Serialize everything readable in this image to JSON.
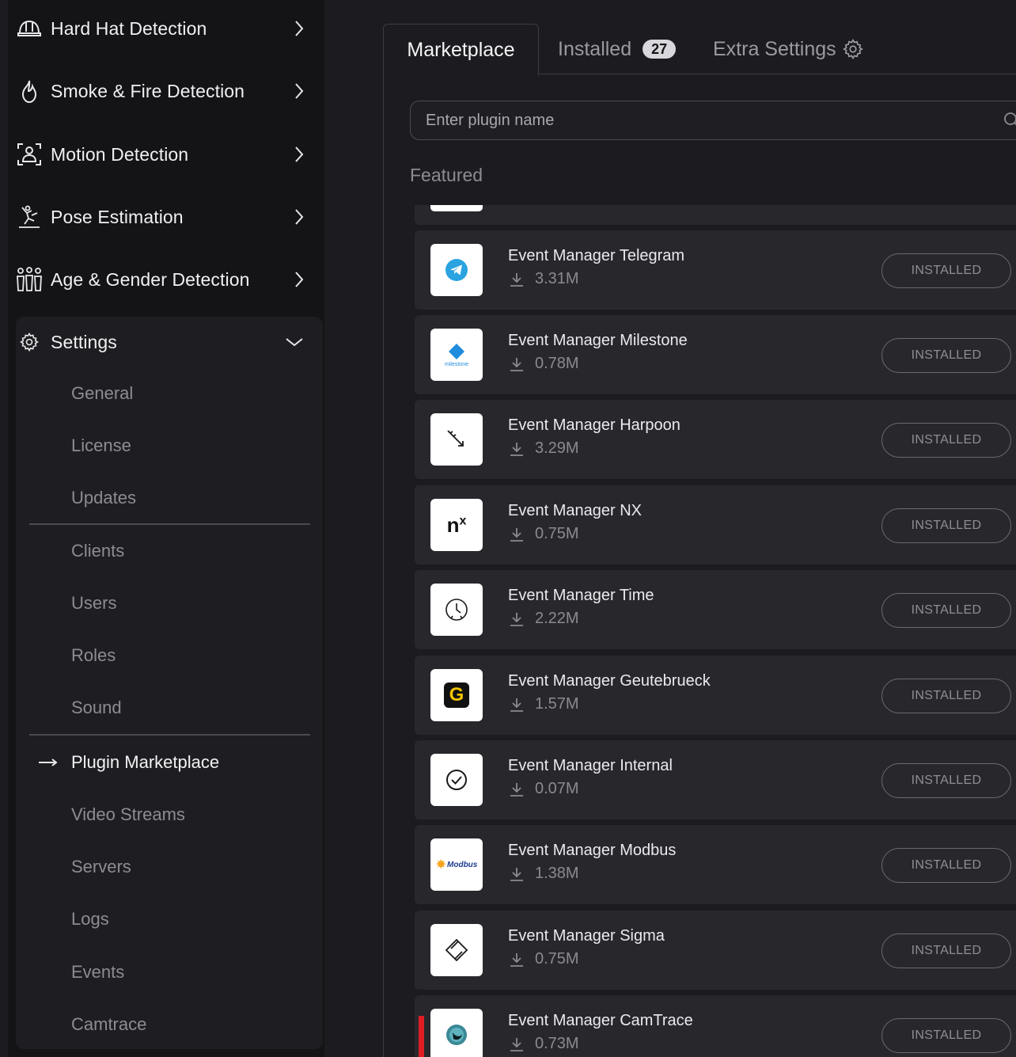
{
  "sidebar": {
    "nav": [
      {
        "label": "Hard Hat Detection",
        "icon": "hard-hat-icon"
      },
      {
        "label": "Smoke & Fire Detection",
        "icon": "fire-icon"
      },
      {
        "label": "Motion Detection",
        "icon": "motion-icon"
      },
      {
        "label": "Pose Estimation",
        "icon": "pose-icon"
      },
      {
        "label": "Age & Gender Detection",
        "icon": "people-icon"
      }
    ],
    "settings": {
      "label": "Settings",
      "icon": "gear-icon",
      "items": [
        {
          "label": "General"
        },
        {
          "label": "License"
        },
        {
          "label": "Updates"
        },
        {
          "label": "Clients"
        },
        {
          "label": "Users"
        },
        {
          "label": "Roles"
        },
        {
          "label": "Sound"
        },
        {
          "label": "Plugin Marketplace",
          "active": true
        },
        {
          "label": "Video Streams"
        },
        {
          "label": "Servers"
        },
        {
          "label": "Logs"
        },
        {
          "label": "Events"
        },
        {
          "label": "Camtrace"
        }
      ]
    }
  },
  "tabs": {
    "marketplace": "Marketplace",
    "installed": "Installed",
    "installed_count": "27",
    "extra": "Extra Settings"
  },
  "search": {
    "placeholder": "Enter plugin name"
  },
  "section_title": "Featured",
  "plugins": [
    {
      "name": "Event Manager Telegram",
      "size": "3.31M",
      "status": "INSTALLED",
      "icon": "telegram-icon"
    },
    {
      "name": "Event Manager Milestone",
      "size": "0.78M",
      "status": "INSTALLED",
      "icon": "milestone-icon",
      "logo_text": "milestone"
    },
    {
      "name": "Event Manager Harpoon",
      "size": "3.29M",
      "status": "INSTALLED",
      "icon": "harpoon-icon"
    },
    {
      "name": "Event Manager NX",
      "size": "0.75M",
      "status": "INSTALLED",
      "icon": "nx-icon",
      "logo_text": "n",
      "logo_sup": "x"
    },
    {
      "name": "Event Manager Time",
      "size": "2.22M",
      "status": "INSTALLED",
      "icon": "clock-icon"
    },
    {
      "name": "Event Manager Geutebrueck",
      "size": "1.57M",
      "status": "INSTALLED",
      "icon": "geutebrueck-icon",
      "logo_text": "G"
    },
    {
      "name": "Event Manager Internal",
      "size": "0.07M",
      "status": "INSTALLED",
      "icon": "check-circle-icon"
    },
    {
      "name": "Event Manager Modbus",
      "size": "1.38M",
      "status": "INSTALLED",
      "icon": "modbus-icon",
      "logo_text": "Modbus"
    },
    {
      "name": "Event Manager Sigma",
      "size": "0.75M",
      "status": "INSTALLED",
      "icon": "sigma-icon"
    },
    {
      "name": "Event Manager CamTrace",
      "size": "0.73M",
      "status": "INSTALLED",
      "icon": "camtrace-icon"
    }
  ],
  "colors": {
    "background": "#1c1c20",
    "sidebar": "#141416",
    "card": "#27272c",
    "telegram": "#2aa3e0",
    "milestone": "#1f8ddc",
    "geutebrueck": "#f5c400",
    "modbus": "#f4a41c",
    "camtrace": "#2f7f8c",
    "marker": "#e01c24"
  }
}
